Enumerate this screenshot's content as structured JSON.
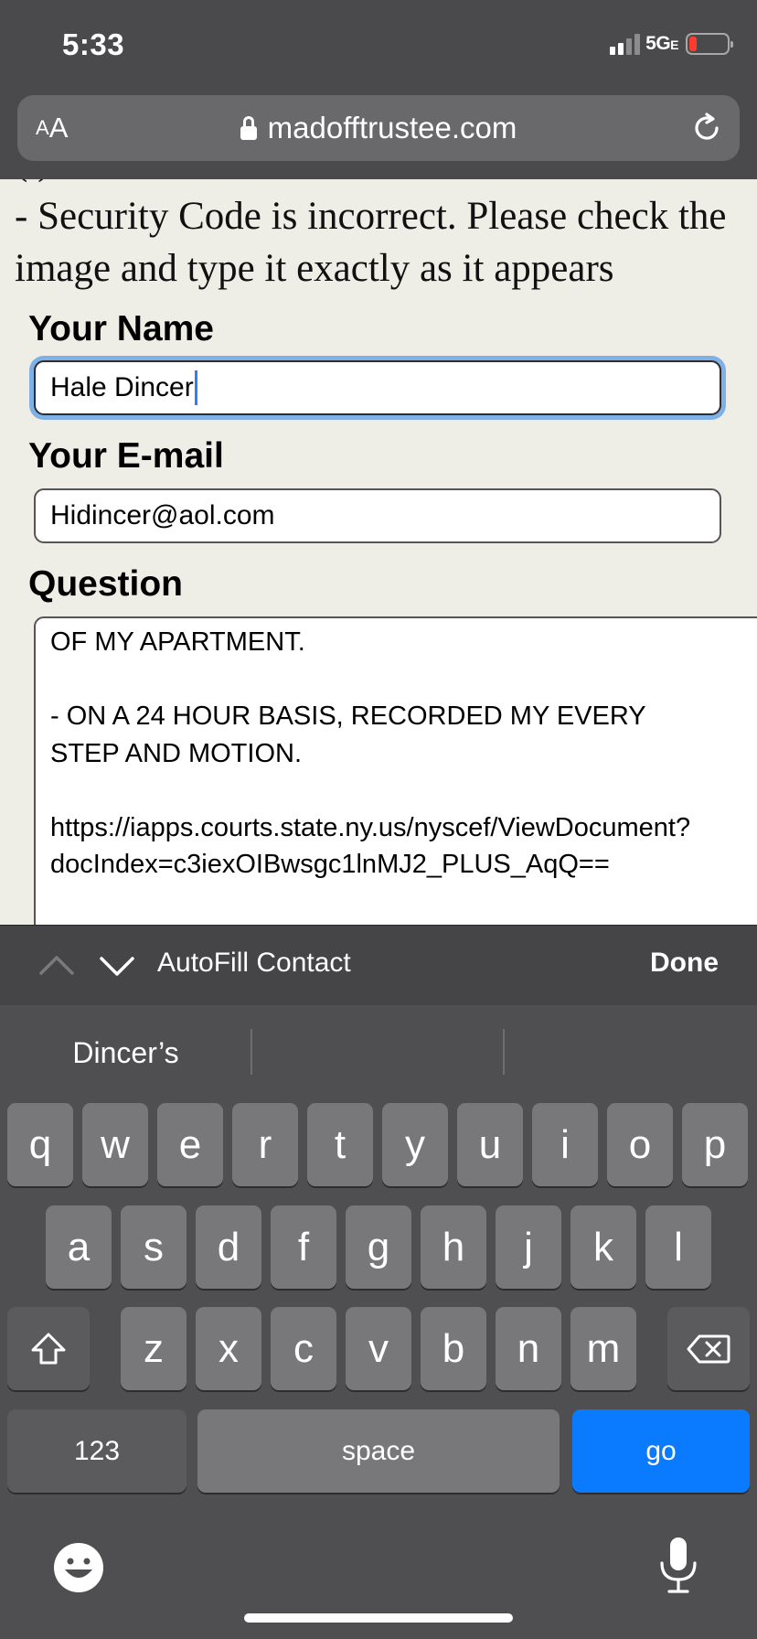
{
  "status_bar": {
    "time": "5:33",
    "network": "5G",
    "network_suffix": "E"
  },
  "browser": {
    "aa_small": "A",
    "aa_big": "A",
    "url": "madofftrustee.com"
  },
  "page": {
    "error_line_1": "- Security Code is incorrect. Please check the",
    "error_line_2": "image and type it exactly as it appears",
    "name_label": "Your Name",
    "name_value": "Hale Dincer",
    "email_label": "Your E-mail",
    "email_value": "Hidincer@aol.com",
    "question_label": "Question",
    "question_lines": [
      "OF MY APARTMENT.",
      "",
      "- ON A 24 HOUR BASIS, RECORDED MY EVERY",
      "STEP AND MOTION.",
      "",
      "https://iapps.courts.state.ny.us/nyscef/ViewDocument?",
      "docIndex=c3iexOIBwsgc1lnMJ2_PLUS_AqQ=="
    ]
  },
  "accessory_bar": {
    "autofill": "AutoFill Contact",
    "done": "Done"
  },
  "keyboard": {
    "suggestions": [
      "Dincer’s",
      "",
      ""
    ],
    "row1": [
      "q",
      "w",
      "e",
      "r",
      "t",
      "y",
      "u",
      "i",
      "o",
      "p"
    ],
    "row2": [
      "a",
      "s",
      "d",
      "f",
      "g",
      "h",
      "j",
      "k",
      "l"
    ],
    "row3": [
      "z",
      "x",
      "c",
      "v",
      "b",
      "n",
      "m"
    ],
    "numbers_key": "123",
    "space_key": "space",
    "go_key": "go"
  },
  "colors": {
    "go_key": "#0a7aff",
    "focus_ring": "#7fb0e8",
    "battery_low": "#ff3b30",
    "page_bg": "#eeede6"
  },
  "icons": [
    "lock-icon",
    "reload-icon",
    "chevron-up-icon",
    "chevron-down-icon",
    "shift-icon",
    "delete-icon",
    "emoji-icon",
    "microphone-icon"
  ]
}
